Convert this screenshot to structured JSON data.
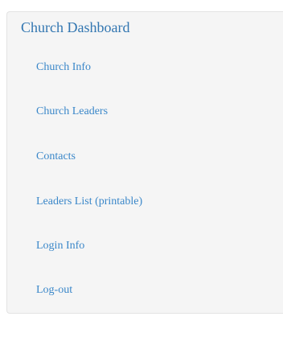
{
  "sidebar": {
    "title": "Church Dashboard",
    "items": [
      {
        "label": "Church Info"
      },
      {
        "label": "Church Leaders"
      },
      {
        "label": "Contacts"
      },
      {
        "label": "Leaders List (printable)"
      },
      {
        "label": "Login Info"
      },
      {
        "label": "Log-out"
      }
    ]
  },
  "colors": {
    "panel_background": "#f5f5f5",
    "title": "#3276b1",
    "link": "#3a87c9"
  }
}
